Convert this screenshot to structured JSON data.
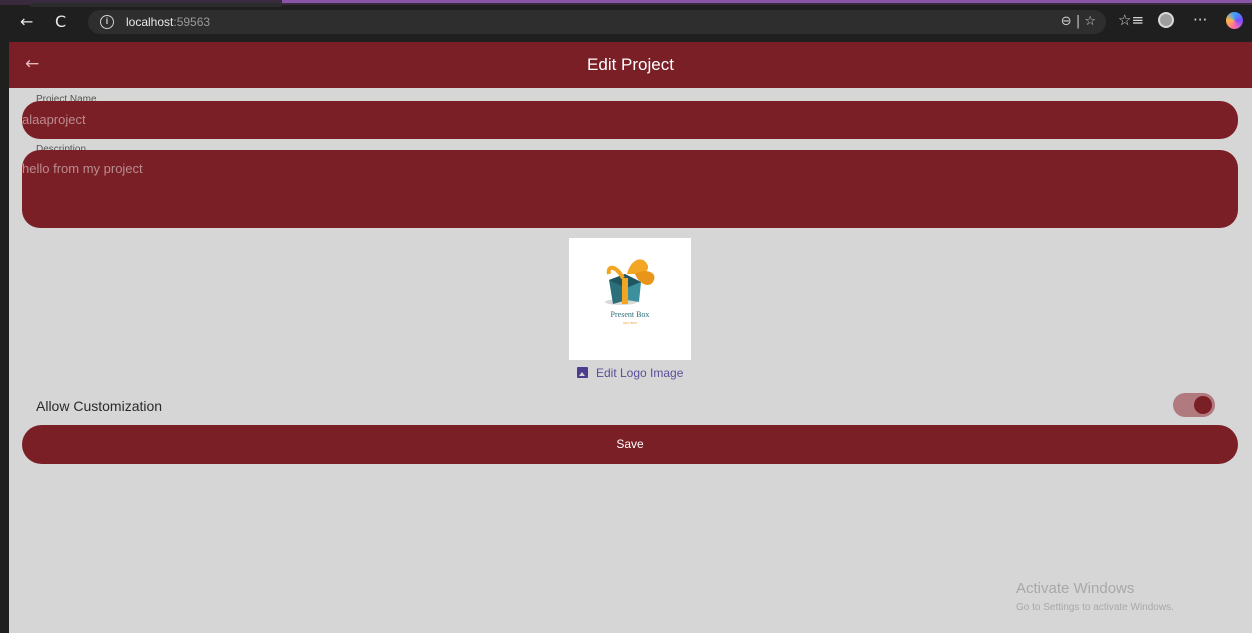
{
  "browser": {
    "back_icon": "←",
    "refresh_icon": "C",
    "url_host": "localhost",
    "url_port": ":59563",
    "address_right": "⊖ | ☆",
    "favorites_icon": "☆≡",
    "more_icon": "···"
  },
  "appbar": {
    "back_icon": "←",
    "title": "Edit Project"
  },
  "form": {
    "project_name_label": "Project Name",
    "project_name_value": "alaaproject",
    "description_label": "Description",
    "description_value": "hello from my project",
    "logo_text": "Present Box",
    "logo_tagline": "GIFT BOX",
    "edit_logo_label": "Edit Logo Image",
    "allow_customization_label": "Allow Customization",
    "allow_customization_on": true,
    "save_label": "Save"
  },
  "watermark": {
    "title": "Activate Windows",
    "subtitle": "Go to Settings to activate Windows."
  },
  "colors": {
    "primary": "#7b1f26",
    "background": "#d6d6d6",
    "link": "#5a4f9a"
  }
}
